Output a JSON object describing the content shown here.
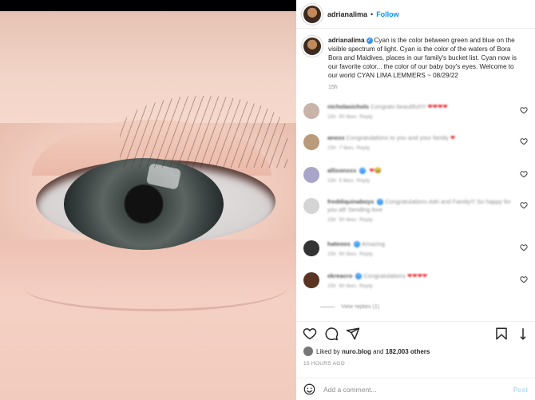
{
  "photo": {
    "alt": "close-up of baby eye"
  },
  "header": {
    "username": "adrianalima",
    "separator": "•",
    "follow_label": "Follow"
  },
  "caption": {
    "username": "adrianalima",
    "text": "Cyan is the color between green and blue on the visible spectrum of light. Cyan is the color of the waters of Bora Bora and Maldives, places in our family's bucket list. Cyan now is our favorite color... the color of our baby boy's eyes. Welcome to our world CYAN LIMA LEMMERS ~ 08/29/22",
    "time": "15h"
  },
  "comments": [
    {
      "username": "nicholasichols",
      "text": "Congrats beautiful!!!!",
      "hearts": "❤❤❤❤",
      "time": "15h",
      "likes": "90 likes",
      "reply": "Reply",
      "avatar_color": "#c8b4a8"
    },
    {
      "username": "anoxx",
      "text": "Congratulations to you and your family",
      "hearts": "❤",
      "time": "15h",
      "likes": "7 likes",
      "reply": "Reply",
      "avatar_color": "#b99a7a"
    },
    {
      "username": "allisonxxx",
      "text": "",
      "hearts": "❤😂",
      "time": "15h",
      "likes": "5 likes",
      "reply": "Reply",
      "avatar_color": "#a7a6c9"
    },
    {
      "username": "freddiquinaboys",
      "text": "Congratulations Adri and Family!!! So happy for you all! Sending love",
      "hearts": "",
      "time": "15h",
      "likes": "90 likes",
      "reply": "Reply",
      "avatar_color": "#d5d5d5"
    },
    {
      "username": "hateoos",
      "text": "Amazing",
      "hearts": "",
      "time": "15h",
      "likes": "90 likes",
      "reply": "Reply",
      "avatar_color": "#333333"
    },
    {
      "username": "ekreacro",
      "text": "Congratulations",
      "hearts": "❤❤❤❤",
      "time": "15h",
      "likes": "90 likes",
      "reply": "Reply",
      "avatar_color": "#5a3322"
    }
  ],
  "view_replies": "View replies (1)",
  "likes": {
    "liked_by_prefix": "Liked by",
    "liked_by_user": "nuro.blog",
    "and": "and",
    "count": "182,003 others"
  },
  "timestamp": "15 HOURS AGO",
  "add_comment": {
    "placeholder": "Add a comment...",
    "post_label": "Post"
  },
  "colors": {
    "follow": "#0095f6",
    "verified": "#3897f0",
    "heart": "#ed1c24"
  }
}
